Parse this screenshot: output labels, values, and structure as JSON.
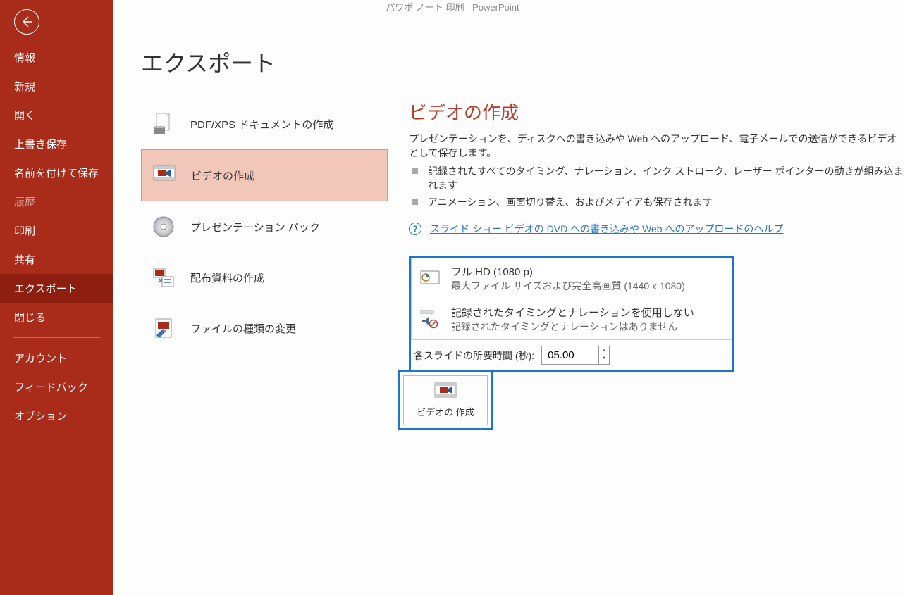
{
  "titlebar": "パワポ ノート 印刷  -  PowerPoint",
  "page_title": "エクスポート",
  "sidebar": {
    "items": [
      {
        "label": "情報"
      },
      {
        "label": "新規"
      },
      {
        "label": "開く"
      },
      {
        "label": "上書き保存"
      },
      {
        "label": "名前を付けて保存"
      },
      {
        "label": "履歴",
        "disabled": true
      },
      {
        "label": "印刷"
      },
      {
        "label": "共有"
      },
      {
        "label": "エクスポート",
        "active": true
      },
      {
        "label": "閉じる"
      }
    ],
    "items2": [
      {
        "label": "アカウント"
      },
      {
        "label": "フィードバック"
      },
      {
        "label": "オプション"
      }
    ]
  },
  "export_options": [
    {
      "label": "PDF/XPS ドキュメントの作成",
      "icon": "pdf-icon"
    },
    {
      "label": "ビデオの作成",
      "icon": "video-icon",
      "selected": true
    },
    {
      "label": "プレゼンテーション パック",
      "icon": "cd-icon"
    },
    {
      "label": "配布資料の作成",
      "icon": "handout-icon"
    },
    {
      "label": "ファイルの種類の変更",
      "icon": "changefile-icon"
    }
  ],
  "detail": {
    "title": "ビデオの作成",
    "desc": "プレゼンテーションを、ディスクへの書き込みや Web へのアップロード、電子メールでの送信ができるビデオとして保存します。",
    "bullets": [
      "記録されたすべてのタイミング、ナレーション、インク ストローク、レーザー ポインターの動きが組み込まれます",
      "アニメーション、画面切り替え、およびメディアも保存されます"
    ],
    "help_link": "スライド ショー ビデオの DVD への書き込みや Web へのアップロードのヘルプ",
    "resolution": {
      "title": "フル HD (1080 p)",
      "sub": "最大ファイル サイズおよび完全高画質 (1440 x 1080)"
    },
    "timing": {
      "title": "記録されたタイミングとナレーションを使用しない",
      "sub": "記録されたタイミングとナレーションはありません"
    },
    "duration_label": "各スライドの所要時間 (秒): ",
    "duration_value": "05.00",
    "create_button": "ビデオの\n作成"
  }
}
